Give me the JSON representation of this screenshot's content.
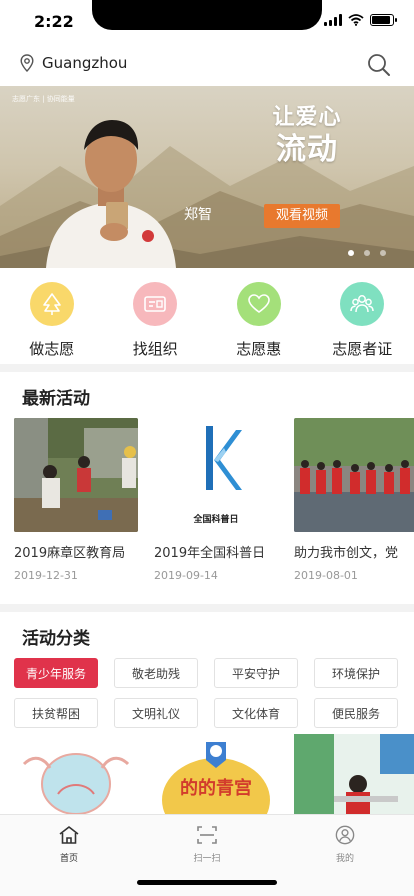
{
  "status_bar": {
    "time": "2:22",
    "signal_icon": "cellular-signal-icon",
    "wifi_icon": "wifi-icon",
    "battery_icon": "battery-icon",
    "battery_level": 0.9
  },
  "header": {
    "location_icon": "location-pin-icon",
    "city": "Guangzhou",
    "search_icon": "search-icon"
  },
  "banner": {
    "source_text": "志愿广东 | 协同能量",
    "slogan_line1": "让爱心",
    "slogan_line2": "流动",
    "person_name": "郑智",
    "cta_label": "观看视频",
    "slide_count": 3,
    "active_slide": 1
  },
  "quick_menu": [
    {
      "label": "做志愿",
      "icon": "tree-icon",
      "color": "#f9d86a"
    },
    {
      "label": "找组织",
      "icon": "id-card-icon",
      "color": "#f7b8bc"
    },
    {
      "label": "志愿惠",
      "icon": "heart-icon",
      "color": "#a4e07a"
    },
    {
      "label": "志愿者证",
      "icon": "people-group-icon",
      "color": "#7fe0c0"
    }
  ],
  "latest": {
    "title": "最新活动",
    "items": [
      {
        "title": "2019麻章区教育局",
        "date": "2019-12-31"
      },
      {
        "title": "2019年全国科普日",
        "date": "2019-09-14",
        "image_caption": "全国科普日"
      },
      {
        "title": "助力我市创文，党",
        "date": "2019-08-01"
      }
    ]
  },
  "category_section": {
    "title": "活动分类",
    "options": [
      "青少年服务",
      "敬老助残",
      "平安守护",
      "环境保护",
      "扶贫帮困",
      "文明礼仪",
      "文化体育",
      "便民服务"
    ],
    "selected": "青少年服务",
    "image_captions": [
      "的的青宫"
    ]
  },
  "tab_bar": [
    {
      "label": "首页",
      "icon": "home-icon",
      "active": true
    },
    {
      "label": "扫一扫",
      "icon": "scan-icon",
      "active": false
    },
    {
      "label": "我的",
      "icon": "user-icon",
      "active": false
    }
  ],
  "colors": {
    "accent_red": "#e0334b",
    "cta_orange": "#e8792e",
    "divider_gray": "#f2f2f2"
  }
}
